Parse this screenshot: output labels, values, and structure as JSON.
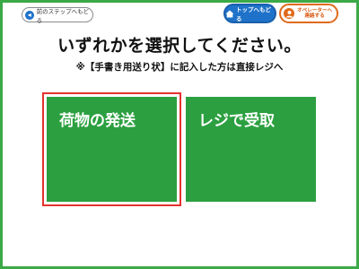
{
  "header": {
    "back_label": "前のステップへもどる",
    "top_label": "トップへもどる",
    "operator_line1": "オペレーターへ",
    "operator_line2": "連絡する"
  },
  "main": {
    "title": "いずれかを選択してください。",
    "note": "※【手書き用送り状】に記入した方は直接レジへ",
    "options": [
      {
        "label": "荷物の発送",
        "selected": true
      },
      {
        "label": "レジで受取",
        "selected": false
      }
    ]
  },
  "colors": {
    "frame": "#3aa946",
    "option_bg": "#2ca040",
    "selection": "#e5322d",
    "top_button": "#1f72c9",
    "operator_accent": "#e06a1a"
  }
}
